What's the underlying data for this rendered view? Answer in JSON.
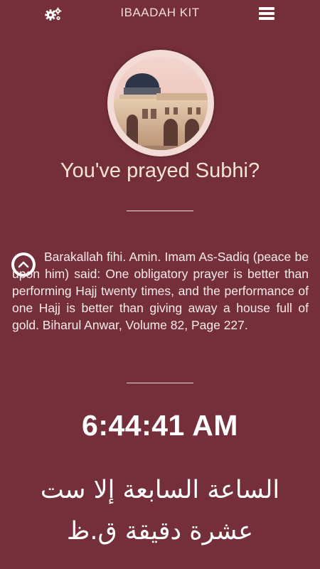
{
  "header": {
    "title": "IBAADAH KIT",
    "settings_icon": "gears-icon",
    "menu_icon": "hamburger-menu-icon"
  },
  "prayer": {
    "image_subject": "mosque",
    "question": "You've prayed Subhi?",
    "collapse_icon": "chevron-up-circle-icon",
    "message": "Barakallah fihi. Amin. Imam As-Sadiq (peace be upon him) said: One obligatory prayer is better than performing Hajj twenty times, and the performance of one Hajj is better than giving away a house full of gold. Biharul Anwar, Volume 82, Page 227."
  },
  "clock": {
    "time": "6:44:41 AM",
    "arabic_time": "الساعة السابعة إلا ست عشرة دقيقة ق.ظ"
  },
  "colors": {
    "background": "#742f3a",
    "accent_text": "#f6e4d2"
  }
}
